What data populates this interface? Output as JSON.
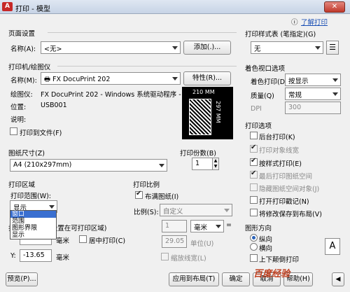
{
  "window": {
    "title": "打印 - 模型",
    "logo_text": "A"
  },
  "help_link": "了解打印",
  "page_setup": {
    "group": "页面设置",
    "name_label": "名称(A):",
    "name_value": "<无>",
    "add_button": "添加(.)..."
  },
  "printer": {
    "group": "打印机/绘图仪",
    "name_label": "名称(M):",
    "name_value": "FX DocuPrint 202",
    "properties_button": "特性(R)...",
    "plotter_label": "绘图仪:",
    "plotter_value": "FX DocuPrint 202 - Windows 系统驱动程序 - ...",
    "location_label": "位置:",
    "location_value": "USB001",
    "desc_label": "说明:",
    "print_to_file": "打印到文件(F)",
    "preview_width": "210 MM",
    "preview_height": "297 MM"
  },
  "paper_size": {
    "group": "图纸尺寸(Z)",
    "value": "A4 (210x297mm)"
  },
  "copies": {
    "label": "打印份数(B)",
    "value": "1"
  },
  "plot_area": {
    "group": "打印区域",
    "range_label": "打印范围(W):",
    "range_value": "显示",
    "options": [
      "窗口",
      "范围",
      "图形界限",
      "显示"
    ]
  },
  "plot_offset": {
    "group": "打印偏移(原点设置在可打印区域)",
    "x_unit": "毫米",
    "y_label": "Y:",
    "y_value": "-13.65",
    "y_unit": "毫米",
    "center_label": "居中打印(C)"
  },
  "plot_scale": {
    "group": "打印比例",
    "fit_label": "布满图纸(I)",
    "scale_label": "比例(S):",
    "scale_value": "自定义",
    "num_value": "1",
    "num_unit": "毫米",
    "equals": "=",
    "den_value": "29.05",
    "den_unit": "单位(U)",
    "lineweights_label": "缩放线宽(L)"
  },
  "plot_style": {
    "group": "打印样式表 (笔指定)(G)",
    "value": "无"
  },
  "shaded_viewport": {
    "group": "着色视口选项",
    "shade_label": "着色打印(D)",
    "shade_value": "按显示",
    "quality_label": "质量(Q)",
    "quality_value": "常规",
    "dpi_label": "DPI",
    "dpi_value": "300"
  },
  "plot_options": {
    "group": "打印选项",
    "items": [
      {
        "label": "后台打印(K)",
        "checked": false,
        "enabled": true
      },
      {
        "label": "打印对象线宽",
        "checked": true,
        "enabled": false
      },
      {
        "label": "按样式打印(E)",
        "checked": true,
        "enabled": true
      },
      {
        "label": "最后打印图纸空间",
        "checked": true,
        "enabled": false
      },
      {
        "label": "隐藏图纸空间对象(J)",
        "checked": false,
        "enabled": false
      },
      {
        "label": "打开打印戳记(N)",
        "checked": false,
        "enabled": true
      },
      {
        "label": "将修改保存到布局(V)",
        "checked": false,
        "enabled": true
      }
    ]
  },
  "orientation": {
    "group": "图形方向",
    "portrait": "纵向",
    "landscape": "横向",
    "upside_down": "上下颠倒打印",
    "icon": "A"
  },
  "footer": {
    "preview": "预览(P)...",
    "apply": "应用到布局(T)",
    "ok": "确定",
    "cancel": "取消",
    "help": "帮助(H)"
  },
  "watermark": "百度经验"
}
